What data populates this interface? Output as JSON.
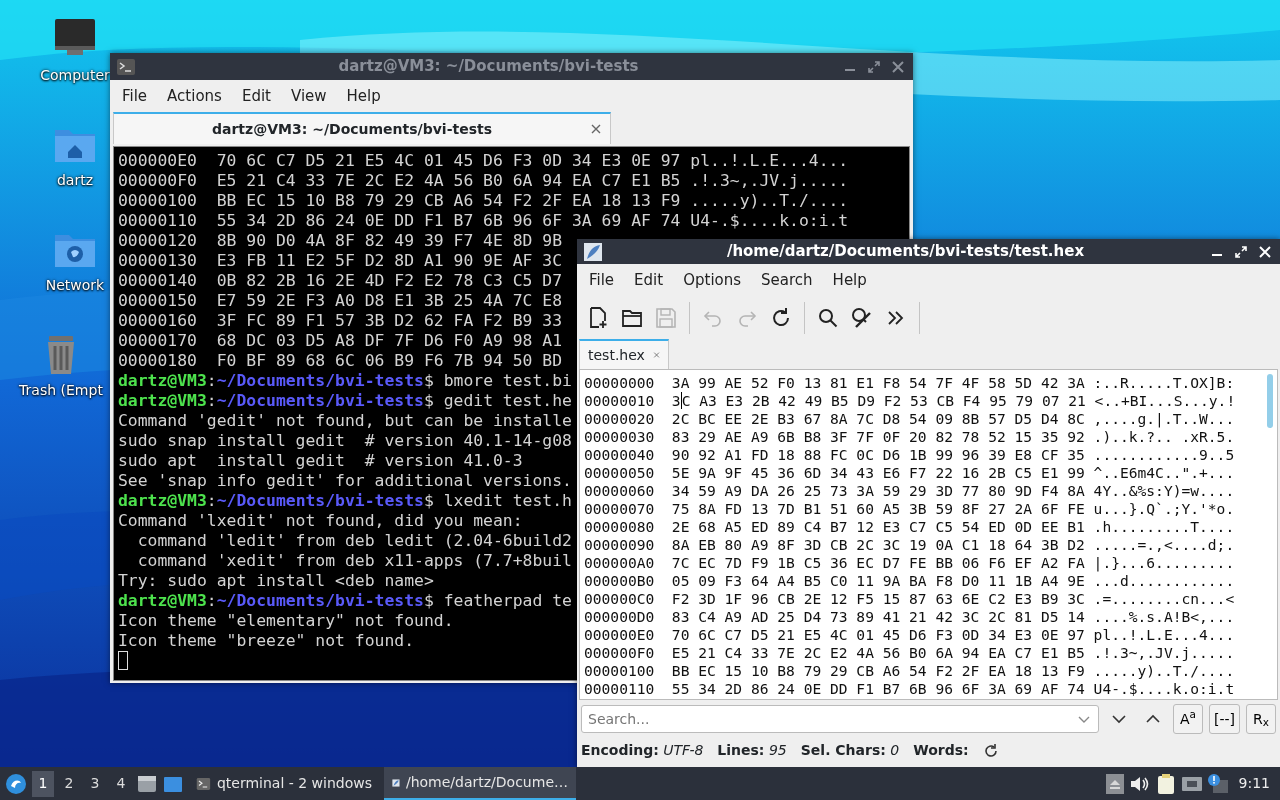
{
  "desktop": {
    "icons": [
      {
        "label": "Computer",
        "kind": "computer"
      },
      {
        "label": "dartz",
        "kind": "home"
      },
      {
        "label": "Network",
        "kind": "network"
      },
      {
        "label": "Trash (Empt",
        "kind": "trash"
      }
    ]
  },
  "terminal": {
    "title": "dartz@VM3: ~/Documents/bvi-tests",
    "active": false,
    "menu": [
      "File",
      "Actions",
      "Edit",
      "View",
      "Help"
    ],
    "tabs": [
      {
        "label": "dartz@VM3: ~/Documents/bvi-tests",
        "selected": true
      }
    ],
    "lines": [
      {
        "kind": "output",
        "text": "000000E0  70 6C C7 D5 21 E5 4C 01 45 D6 F3 0D 34 E3 0E 97 pl..!.L.E...4..."
      },
      {
        "kind": "output",
        "text": "000000F0  E5 21 C4 33 7E 2C E2 4A 56 B0 6A 94 EA C7 E1 B5 .!.3~,.JV.j....."
      },
      {
        "kind": "output",
        "text": "00000100  BB EC 15 10 B8 79 29 CB A6 54 F2 2F EA 18 13 F9 .....y)..T./...."
      },
      {
        "kind": "output",
        "text": "00000110  55 34 2D 86 24 0E DD F1 B7 6B 96 6F 3A 69 AF 74 U4-.$....k.o:i.t"
      },
      {
        "kind": "output",
        "text": "00000120  8B 90 D0 4A 8F 82 49 39 F7 4E 8D 9B"
      },
      {
        "kind": "output",
        "text": "00000130  E3 FB 11 E2 5F D2 8D A1 90 9E AF 3C"
      },
      {
        "kind": "output",
        "text": "00000140  0B 82 2B 16 2E 4D F2 E2 78 C3 C5 D7"
      },
      {
        "kind": "output",
        "text": "00000150  E7 59 2E F3 A0 D8 E1 3B 25 4A 7C E8"
      },
      {
        "kind": "output",
        "text": "00000160  3F FC 89 F1 57 3B D2 62 FA F2 B9 33"
      },
      {
        "kind": "output",
        "text": "00000170  68 DC 03 D5 A8 DF 7F D6 F0 A9 98 A1"
      },
      {
        "kind": "output",
        "text": "00000180  F0 BF 89 68 6C 06 B9 F6 7B 94 50 BD"
      },
      {
        "kind": "prompt",
        "parts": [
          "dartz@VM3",
          ":",
          "~/Documents/bvi-tests",
          "$ bmore test.bi"
        ]
      },
      {
        "kind": "prompt",
        "parts": [
          "dartz@VM3",
          ":",
          "~/Documents/bvi-tests",
          "$ gedit test.he"
        ]
      },
      {
        "kind": "output",
        "text": "Command 'gedit' not found, but can be installe"
      },
      {
        "kind": "output",
        "text": "sudo snap install gedit  # version 40.1-14-g08"
      },
      {
        "kind": "output",
        "text": "sudo apt  install gedit  # version 41.0-3"
      },
      {
        "kind": "output",
        "text": "See 'snap info gedit' for additional versions."
      },
      {
        "kind": "prompt",
        "parts": [
          "dartz@VM3",
          ":",
          "~/Documents/bvi-tests",
          "$ lxedit test.h"
        ]
      },
      {
        "kind": "output",
        "text": "Command 'lxedit' not found, did you mean:"
      },
      {
        "kind": "output",
        "text": "  command 'ledit' from deb ledit (2.04-6build2"
      },
      {
        "kind": "output",
        "text": "  command 'xedit' from deb x11-apps (7.7+8buil"
      },
      {
        "kind": "output",
        "text": "Try: sudo apt install <deb name>"
      },
      {
        "kind": "prompt",
        "parts": [
          "dartz@VM3",
          ":",
          "~/Documents/bvi-tests",
          "$ featherpad te"
        ]
      },
      {
        "kind": "output",
        "text": "Icon theme \"elementary\" not found."
      },
      {
        "kind": "output",
        "text": "Icon theme \"breeze\" not found."
      },
      {
        "kind": "cursor"
      }
    ]
  },
  "editor": {
    "title": "/home/dartz/Documents/bvi-tests/test.hex",
    "active": true,
    "menu": [
      "File",
      "Edit",
      "Options",
      "Search",
      "Help"
    ],
    "toolbar": [
      {
        "kind": "new",
        "disabled": false
      },
      {
        "kind": "open",
        "disabled": false
      },
      {
        "kind": "save",
        "disabled": true
      },
      {
        "kind": "separator"
      },
      {
        "kind": "undo",
        "disabled": true
      },
      {
        "kind": "redo",
        "disabled": true
      },
      {
        "kind": "reload",
        "disabled": false
      },
      {
        "kind": "separator"
      },
      {
        "kind": "find",
        "disabled": false
      },
      {
        "kind": "replace",
        "disabled": false
      },
      {
        "kind": "more",
        "disabled": false
      },
      {
        "kind": "separator"
      }
    ],
    "tabs": [
      {
        "label": "test.hex",
        "selected": true
      }
    ],
    "rows": [
      {
        "text": "00000000  3A 99 AE 52 F0 13 81 E1 F8 54 7F 4F 58 5D 42 3A :..R.....T.OX]B:"
      },
      {
        "text": "00000010  3",
        "text_after_caret": "C A3 E3 2B 42 49 B5 D9 F2 53 CB F4 95 79 07 21 <..+BI...S...y.!"
      },
      {
        "text": "00000020  2C BC EE 2E B3 67 8A 7C D8 54 09 8B 57 D5 D4 8C ,....g.|.T..W..."
      },
      {
        "text": "00000030  83 29 AE A9 6B B8 3F 7F 0F 20 82 78 52 15 35 92 .)..k.?.. .xR.5."
      },
      {
        "text": "00000040  90 92 A1 FD 18 88 FC 0C D6 1B 99 96 39 E8 CF 35 ............9..5"
      },
      {
        "text": "00000050  5E 9A 9F 45 36 6D 34 43 E6 F7 22 16 2B C5 E1 99 ^..E6m4C..\".+..."
      },
      {
        "text": "00000060  34 59 A9 DA 26 25 73 3A 59 29 3D 77 80 9D F4 8A 4Y..&%s:Y)=w...."
      },
      {
        "text": "00000070  75 8A FD 13 7D B1 51 60 A5 3B 59 8F 27 2A 6F FE u...}.Q`.;Y.'*o."
      },
      {
        "text": "00000080  2E 68 A5 ED 89 C4 B7 12 E3 C7 C5 54 ED 0D EE B1 .h.........T...."
      },
      {
        "text": "00000090  8A EB 80 A9 8F 3D CB 2C 3C 19 0A C1 18 64 3B D2 .....=.,<....d;."
      },
      {
        "text": "000000A0  7C EC 7D F9 1B C5 36 EC D7 FE BB 06 F6 EF A2 FA |.}...6........."
      },
      {
        "text": "000000B0  05 09 F3 64 A4 B5 C0 11 9A BA F8 D0 11 1B A4 9E ...d............"
      },
      {
        "text": "000000C0  F2 3D 1F 96 CB 2E 12 F5 15 87 63 6E C2 E3 B9 3C .=........cn...<"
      },
      {
        "text": "000000D0  83 C4 A9 AD 25 D4 73 89 41 21 42 3C 2C 81 D5 14 ....%.s.A!B<,..."
      },
      {
        "text": "000000E0  70 6C C7 D5 21 E5 4C 01 45 D6 F3 0D 34 E3 0E 97 pl..!.L.E...4..."
      },
      {
        "text": "000000F0  E5 21 C4 33 7E 2C E2 4A 56 B0 6A 94 EA C7 E1 B5 .!.3~,.JV.j....."
      },
      {
        "text": "00000100  BB EC 15 10 B8 79 29 CB A6 54 F2 2F EA 18 13 F9 .....y)..T./...."
      },
      {
        "text": "00000110  55 34 2D 86 24 0E DD F1 B7 6B 96 6F 3A 69 AF 74 U4-.$....k.o:i.t"
      }
    ],
    "search": {
      "placeholder": "Search..."
    },
    "search_buttons": [
      {
        "kind": "down"
      },
      {
        "kind": "up"
      },
      {
        "kind": "toggle",
        "label": "A$^{a}$"
      },
      {
        "kind": "toggle",
        "label": "[--]"
      },
      {
        "kind": "toggle",
        "label": "R$_{x}$"
      }
    ],
    "status": [
      "**Encoding:** *UTF-8*",
      "**Lines:** *95*",
      "**Sel. Chars:** *0*",
      "**Words:**"
    ]
  },
  "taskbar": {
    "workspaces": [
      {
        "label": "1",
        "selected": true
      },
      {
        "label": "2",
        "selected": false
      },
      {
        "label": "3",
        "selected": false
      },
      {
        "label": "4",
        "selected": false
      }
    ],
    "tasks": [
      {
        "label": "qterminal - 2 windows",
        "kind": "terminal",
        "selected": false
      },
      {
        "label": "/home/dartz/Docume…",
        "kind": "editor",
        "selected": true
      }
    ],
    "clock": "9:11"
  }
}
